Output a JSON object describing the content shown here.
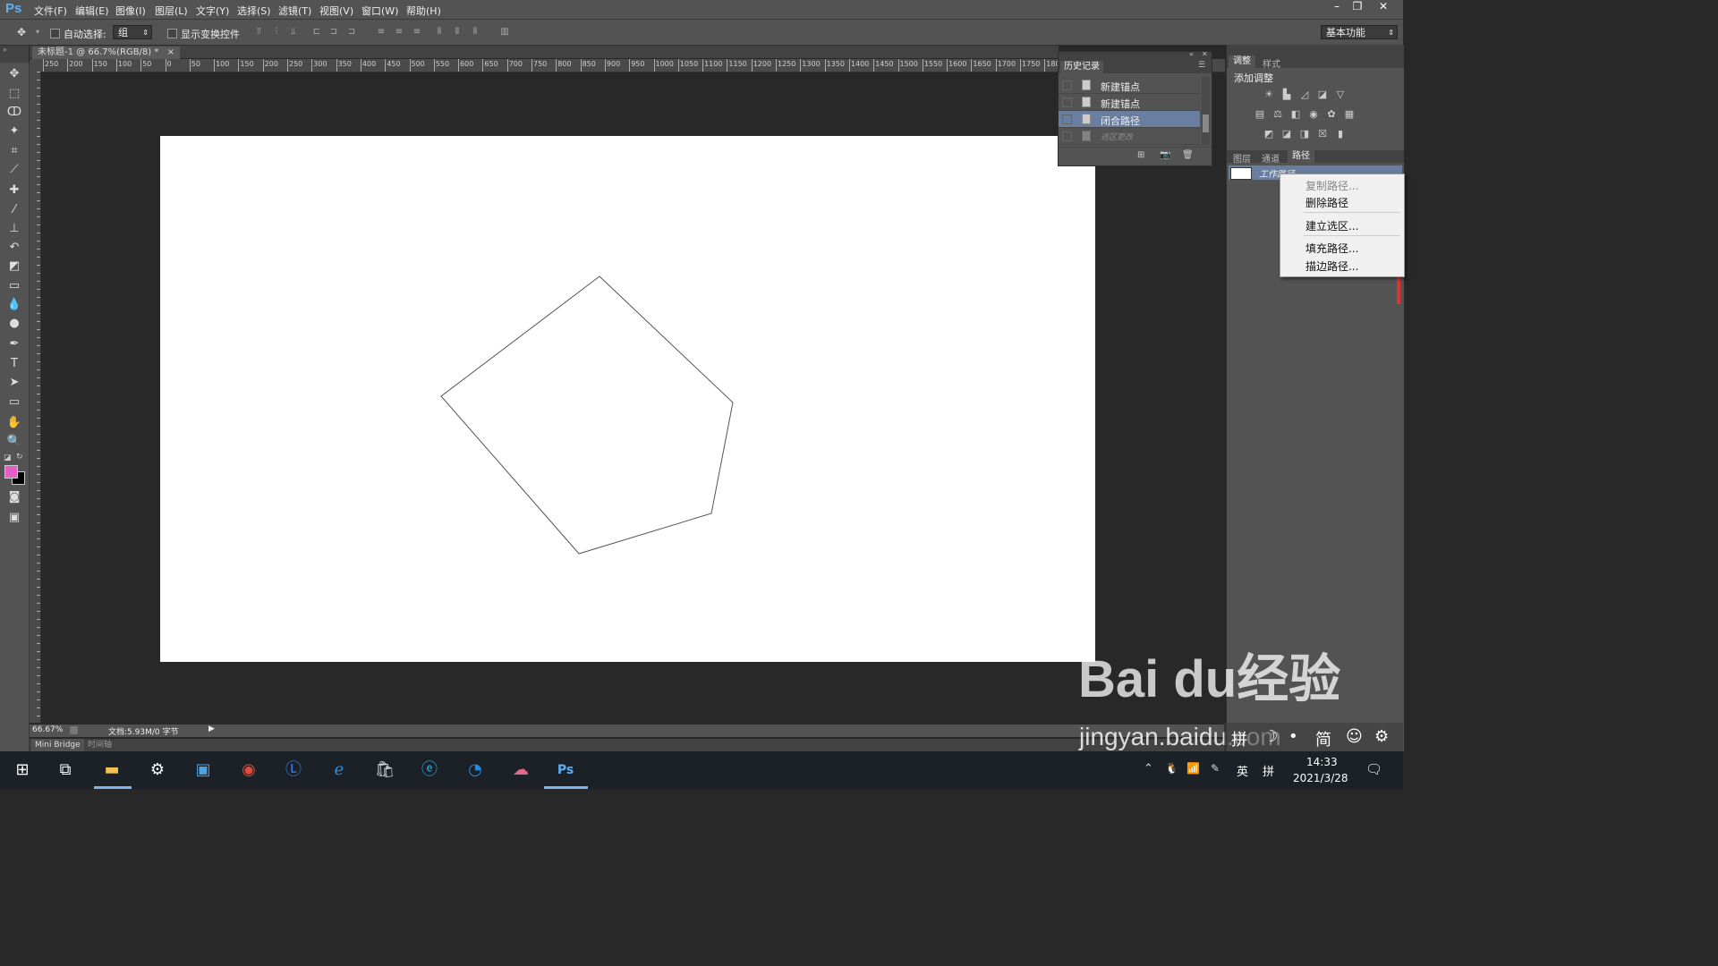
{
  "app": {
    "logo": "Ps",
    "menu": [
      "文件(F)",
      "编辑(E)",
      "图像(I)",
      "图层(L)",
      "文字(Y)",
      "选择(S)",
      "滤镜(T)",
      "视图(V)",
      "窗口(W)",
      "帮助(H)"
    ],
    "window_controls": [
      "–",
      "❐",
      "✕"
    ]
  },
  "options_bar": {
    "auto_select_label": "自动选择:",
    "auto_select_value": "组",
    "show_transform_label": "显示变换控件",
    "workspace": "基本功能"
  },
  "document": {
    "tab_title": "未标题-1 @ 66.7%(RGB/8) *",
    "tab_close": "×",
    "ruler_h": [
      "250",
      "200",
      "150",
      "100",
      "50",
      "0",
      "50",
      "100",
      "150",
      "200",
      "250",
      "300",
      "350",
      "400",
      "450",
      "500",
      "550",
      "600",
      "650",
      "700",
      "750",
      "800",
      "850",
      "900",
      "950",
      "1000",
      "1050",
      "1100",
      "1150",
      "1200",
      "1250",
      "1300",
      "1350",
      "1400",
      "1450",
      "1500",
      "1550",
      "1600",
      "1650",
      "1700",
      "1750",
      "1800"
    ],
    "zoom": "66.67%",
    "doc_info": "文档:5.93M/0 字节"
  },
  "bottom_tabs": [
    "Mini Bridge",
    "时间轴"
  ],
  "history_panel": {
    "title": "历史记录",
    "items": [
      "新建锚点",
      "新建锚点",
      "闭合路径",
      "选区更改"
    ]
  },
  "adjust_panel": {
    "tabs": [
      "调整",
      "样式"
    ],
    "subtitle": "添加调整"
  },
  "layers_panel": {
    "tabs": [
      "图层",
      "通道",
      "路径"
    ],
    "work_path": "工作路径"
  },
  "context_menu": {
    "items": [
      "复制路径...",
      "删除路径",
      "建立选区...",
      "填充路径...",
      "描边路径..."
    ]
  },
  "taskbar": {
    "time": "14:33",
    "date": "2021/3/28",
    "ime_lang": "英",
    "ime_mode": "拼",
    "ime_simp": "简"
  },
  "watermark": {
    "brand": "Bai du经验",
    "url": "jingyan.baidu.com"
  }
}
